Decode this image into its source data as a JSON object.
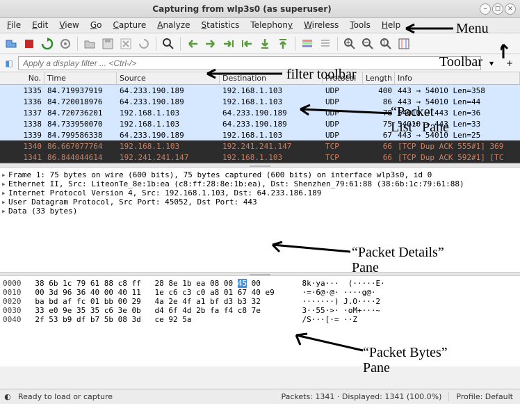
{
  "window": {
    "title": "Capturing from wlp3s0 (as superuser)"
  },
  "menu": {
    "file": "File",
    "edit": "Edit",
    "view": "View",
    "go": "Go",
    "capture": "Capture",
    "analyze": "Analyze",
    "statistics": "Statistics",
    "telephony": "Telephony",
    "wireless": "Wireless",
    "tools": "Tools",
    "help": "Help"
  },
  "filter": {
    "placeholder": "Apply a display filter ... <Ctrl-/>"
  },
  "columns": {
    "no": "No.",
    "time": "Time",
    "source": "Source",
    "destination": "Destination",
    "protocol": "Protocol",
    "length": "Length",
    "info": "Info"
  },
  "packets": [
    {
      "no": "1335",
      "time": "84.719937919",
      "src": "64.233.190.189",
      "dst": "192.168.1.103",
      "proto": "UDP",
      "len": "400",
      "info": "443 → 54010 Len=358",
      "cls": "udp"
    },
    {
      "no": "1336",
      "time": "84.720018976",
      "src": "64.233.190.189",
      "dst": "192.168.1.103",
      "proto": "UDP",
      "len": "86",
      "info": "443 → 54010 Len=44",
      "cls": "udp"
    },
    {
      "no": "1337",
      "time": "84.720736201",
      "src": "192.168.1.103",
      "dst": "64.233.190.189",
      "proto": "UDP",
      "len": "78",
      "info": "54010 → 443 Len=36",
      "cls": "udp"
    },
    {
      "no": "1338",
      "time": "84.733950070",
      "src": "192.168.1.103",
      "dst": "64.233.190.189",
      "proto": "UDP",
      "len": "75",
      "info": "54010 → 443 Len=33",
      "cls": "udp"
    },
    {
      "no": "1339",
      "time": "84.799586338",
      "src": "64.233.190.189",
      "dst": "192.168.1.103",
      "proto": "UDP",
      "len": "67",
      "info": "443 → 54010 Len=25",
      "cls": "udp"
    },
    {
      "no": "1340",
      "time": "86.667077764",
      "src": "192.168.1.103",
      "dst": "192.241.241.147",
      "proto": "TCP",
      "len": "66",
      "info": "[TCP Dup ACK 555#1] 369",
      "cls": "tcp"
    },
    {
      "no": "1341",
      "time": "86.844044614",
      "src": "192.241.241.147",
      "dst": "192.168.1.103",
      "proto": "TCP",
      "len": "66",
      "info": "[TCP Dup ACK 592#1]  [TC",
      "cls": "tcp"
    }
  ],
  "details": [
    "Frame 1: 75 bytes on wire (600 bits), 75 bytes captured (600 bits) on interface wlp3s0, id 0",
    "Ethernet II, Src: LiteonTe_8e:1b:ea (c8:ff:28:8e:1b:ea), Dst: Shenzhen_79:61:88 (38:6b:1c:79:61:88)",
    "Internet Protocol Version 4, Src: 192.168.1.103, Dst: 64.233.186.189",
    "User Datagram Protocol, Src Port: 45052, Dst Port: 443",
    "Data (33 bytes)"
  ],
  "bytes": [
    {
      "off": "0000",
      "hex_a": "38 6b 1c 79 61 88 c8 ff",
      "hex_b": "28 8e 1b ea 08 00 ",
      "hl": "45",
      "hex_c": " 00",
      "ascii": "8k·ya···  (·····E·"
    },
    {
      "off": "0010",
      "hex_a": "00 3d 96 36 40 00 40 11",
      "hex_b": "1e c6 c3 c0 a8 01 67 40 e9",
      "hl": "",
      "hex_c": "",
      "ascii": "·=·6@·@· ····g@·"
    },
    {
      "off": "0020",
      "hex_a": "ba bd af fc 01 bb 00 29",
      "hex_b": "4a 2e 4f a1 bf d3 b3 32",
      "hl": "",
      "hex_c": "",
      "ascii": "·······) J.O····2"
    },
    {
      "off": "0030",
      "hex_a": "33 e0 9e 35 35 c6 3e 0b",
      "hex_b": "d4 6f 4d 2b fa f4 c8 7e",
      "hl": "",
      "hex_c": "",
      "ascii": "3··55·>· ·oM+···~"
    },
    {
      "off": "0040",
      "hex_a": "2f 53 b9 df b7 5b 08 3d",
      "hex_b": "ce 92 5a",
      "hl": "",
      "hex_c": "",
      "ascii": "/S···[·= ··Z"
    }
  ],
  "status": {
    "left": "Ready to load or capture",
    "mid": "Packets: 1341 · Displayed: 1341 (100.0%)",
    "right": "Profile: Default"
  },
  "annotations": {
    "menu": "Menu",
    "toolbar": "Toolbar",
    "filter": "filter toolbar",
    "list": "“Packet\nList” Pane",
    "details": "“Packet Details”\nPane",
    "bytes": "“Packet Bytes”\nPane"
  }
}
